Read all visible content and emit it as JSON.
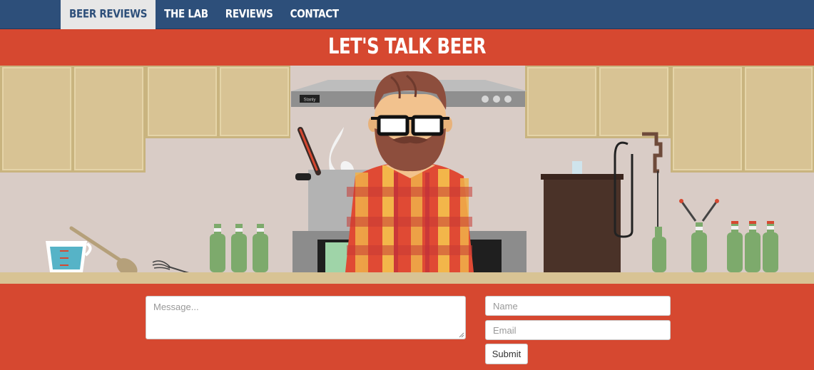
{
  "nav": {
    "items": [
      {
        "label": "BEER REVIEWS",
        "active": true
      },
      {
        "label": "THE LAB",
        "active": false
      },
      {
        "label": "REVIEWS",
        "active": false
      },
      {
        "label": "CONTACT",
        "active": false
      }
    ]
  },
  "hero": {
    "title": "LET'S TALK BEER",
    "stove_label": "Stanly"
  },
  "form": {
    "message_placeholder": "Message...",
    "name_placeholder": "Name",
    "email_placeholder": "Email",
    "submit_label": "Submit"
  },
  "colors": {
    "nav_bg": "#2d4f7a",
    "accent_red": "#d64830",
    "active_tab_bg": "#e7e7e7",
    "cabinet": "#d8c394",
    "wall": "#d9ccc6"
  }
}
